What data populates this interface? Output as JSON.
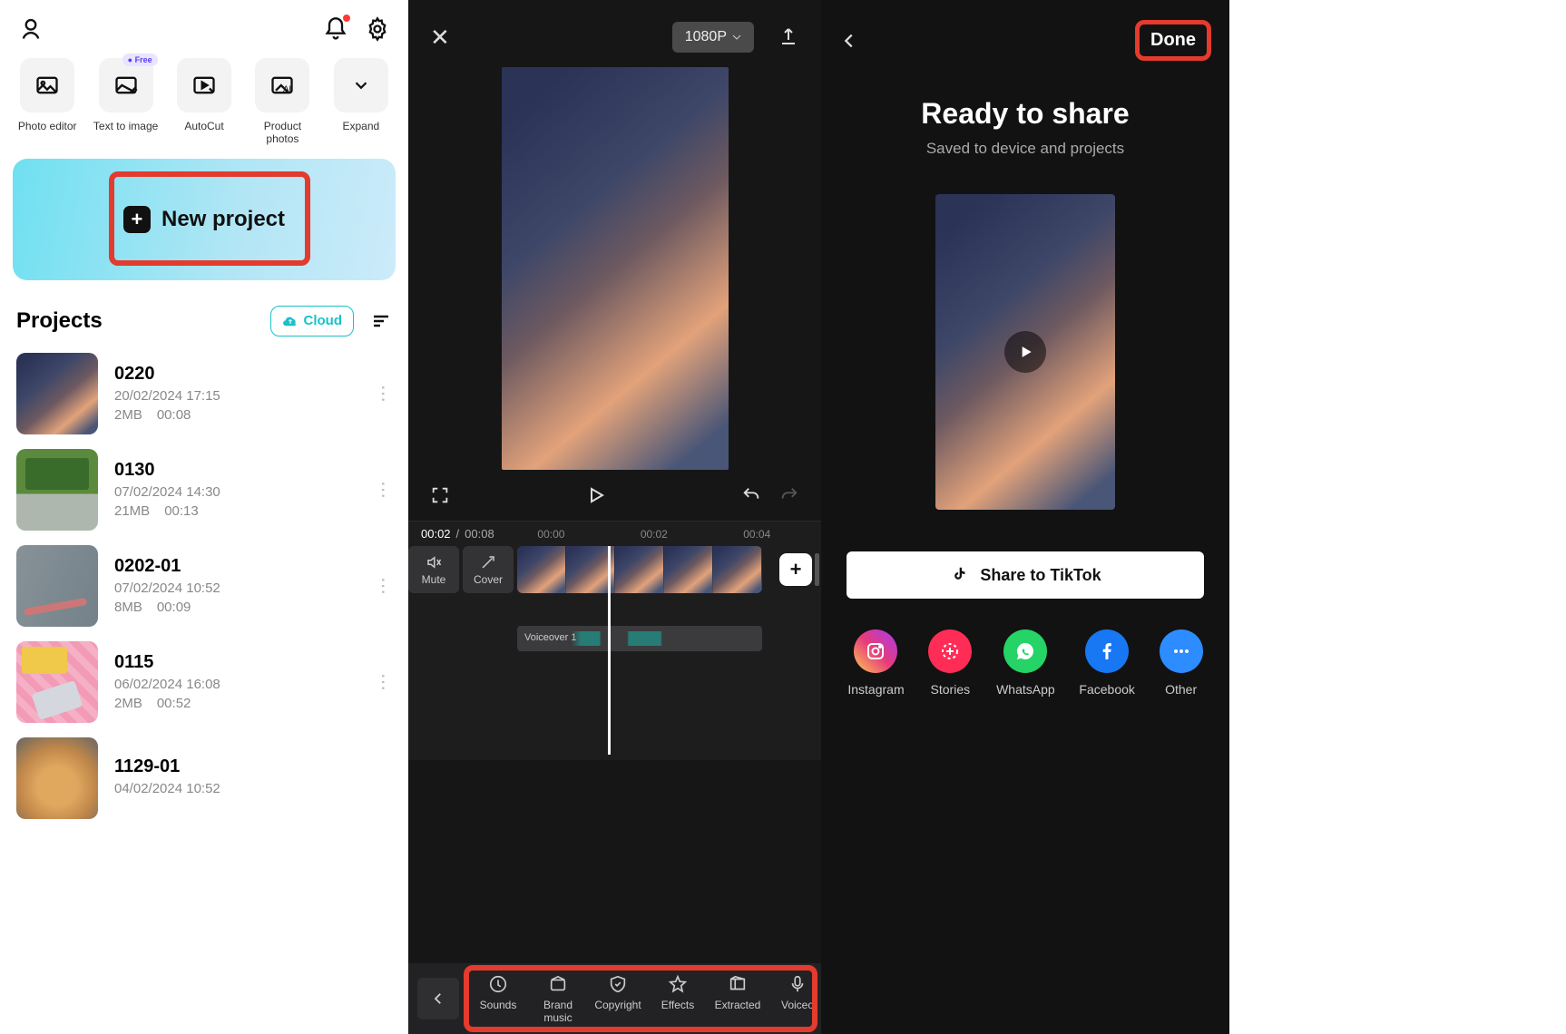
{
  "left": {
    "free_badge": "Free",
    "tools": [
      {
        "label": "Photo editor"
      },
      {
        "label": "Text to image"
      },
      {
        "label": "AutoCut"
      },
      {
        "label": "Product photos"
      },
      {
        "label": "Expand"
      }
    ],
    "new_project": "New project",
    "projects_title": "Projects",
    "cloud_btn": "Cloud",
    "projects": [
      {
        "name": "0220",
        "date": "20/02/2024 17:15",
        "size": "2MB",
        "dur": "00:08",
        "thumb": "gradient"
      },
      {
        "name": "0130",
        "date": "07/02/2024 14:30",
        "size": "21MB",
        "dur": "00:13",
        "thumb": "park"
      },
      {
        "name": "0202-01",
        "date": "07/02/2024 10:52",
        "size": "8MB",
        "dur": "00:09",
        "thumb": "pencil"
      },
      {
        "name": "0115",
        "date": "06/02/2024 16:08",
        "size": "2MB",
        "dur": "00:52",
        "thumb": "pink"
      },
      {
        "name": "1129-01",
        "date": "04/02/2024 10:52",
        "size": "",
        "dur": "",
        "thumb": "dog"
      }
    ]
  },
  "mid": {
    "resolution": "1080P",
    "time_current": "00:02",
    "time_total": "00:08",
    "ticks": [
      "00:00",
      "00:02",
      "00:04"
    ],
    "mute": "Mute",
    "cover": "Cover",
    "voiceover_label": "Voiceover 1",
    "bottom_tools": [
      "Sounds",
      "Brand music",
      "Copyright",
      "Effects",
      "Extracted",
      "Voiceo"
    ]
  },
  "right": {
    "done": "Done",
    "title": "Ready to share",
    "subtitle": "Saved to device and projects",
    "tiktok": "Share to TikTok",
    "share_targets": [
      "Instagram",
      "Stories",
      "WhatsApp",
      "Facebook",
      "Other"
    ]
  }
}
